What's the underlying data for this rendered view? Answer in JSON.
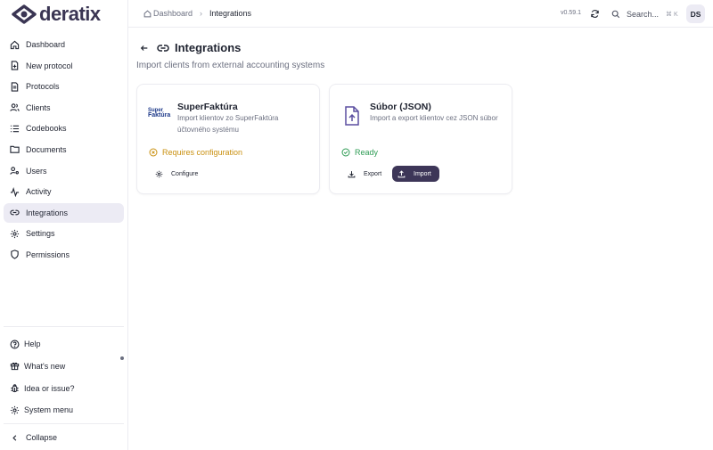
{
  "app": {
    "name": "deratix",
    "version": "v0.59.1",
    "user_initials": "DS"
  },
  "breadcrumb": {
    "home": "Dashboard",
    "current": "Integrations"
  },
  "search": {
    "placeholder": "Search...",
    "shortcut": "⌘ K"
  },
  "sidebar": {
    "items": [
      {
        "label": "Dashboard",
        "icon": "home-icon"
      },
      {
        "label": "New protocol",
        "icon": "file-plus-icon"
      },
      {
        "label": "Protocols",
        "icon": "file-text-icon"
      },
      {
        "label": "Clients",
        "icon": "users-icon"
      },
      {
        "label": "Codebooks",
        "icon": "list-icon"
      },
      {
        "label": "Documents",
        "icon": "folder-icon"
      },
      {
        "label": "Users",
        "icon": "user-key-icon"
      },
      {
        "label": "Activity",
        "icon": "activity-icon"
      },
      {
        "label": "Integrations",
        "icon": "link-icon",
        "active": true
      },
      {
        "label": "Settings",
        "icon": "gear-icon"
      },
      {
        "label": "Permissions",
        "icon": "shield-icon"
      }
    ],
    "bottom": [
      {
        "label": "Help",
        "icon": "help-icon"
      },
      {
        "label": "What's new",
        "icon": "gift-icon"
      },
      {
        "label": "Idea or issue?",
        "icon": "bug-icon"
      },
      {
        "label": "System menu",
        "icon": "gear-icon"
      }
    ],
    "collapse": "Collapse"
  },
  "page": {
    "title": "Integrations",
    "subtitle": "Import clients from external accounting systems"
  },
  "integrations": [
    {
      "name": "SuperFaktúra",
      "description": "Import klientov zo SuperFaktúra účtovného systému",
      "status": "Requires configuration",
      "logo_text_small": "Super",
      "logo_text": "Faktúra",
      "action": "Configure"
    },
    {
      "name": "Súbor (JSON)",
      "description": "Import a export klientov cez JSON súbor",
      "status": "Ready",
      "export_label": "Export",
      "import_label": "Import"
    }
  ],
  "colors": {
    "accent": "#3d3658",
    "warning": "#c99010",
    "success": "#2f9c55",
    "active_bg": "#ecebf4"
  }
}
